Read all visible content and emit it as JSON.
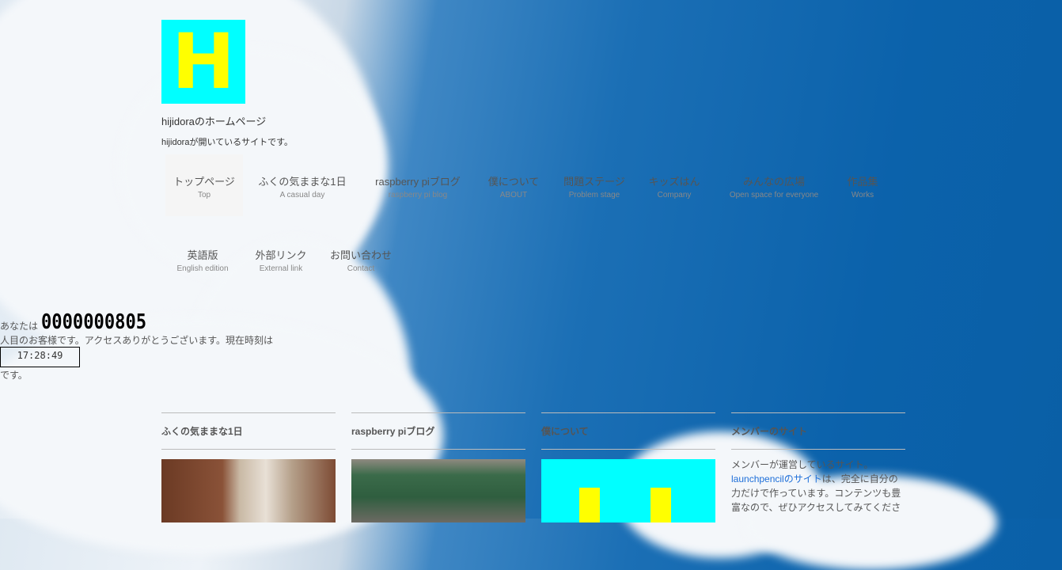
{
  "site": {
    "logo_letter": "H",
    "title": "hijidoraのホームページ",
    "description": "hijidoraが開いているサイトです。"
  },
  "nav": [
    {
      "label": "トップページ",
      "sub": "Top"
    },
    {
      "label": "ふくの気ままな1日",
      "sub": "A casual day"
    },
    {
      "label": "raspberry piブログ",
      "sub": "raspberry pi blog"
    },
    {
      "label": "僕について",
      "sub": "ABOUT"
    },
    {
      "label": "問題ステージ",
      "sub": "Problem stage"
    },
    {
      "label": "キッズはん",
      "sub": "Company"
    },
    {
      "label": "みんなの広場",
      "sub": "Open space for everyone"
    },
    {
      "label": "作品集",
      "sub": "Works"
    },
    {
      "label": "英語版",
      "sub": "English edition"
    },
    {
      "label": "外部リンク",
      "sub": "External link"
    },
    {
      "label": "お問い合わせ",
      "sub": "Contact"
    }
  ],
  "counter": {
    "prefix": "あなたは",
    "number": "0000000805",
    "line2": "人目のお客様です。アクセスありがとうございます。現在時刻は",
    "time": "17:28:49",
    "line3": "です。"
  },
  "widgets": [
    {
      "title": "ふくの気ままな1日"
    },
    {
      "title": "raspberry piブログ"
    },
    {
      "title": "僕について"
    },
    {
      "title": "メンバーのサイト",
      "text_pre": "メンバーが運営しているサイト。",
      "link": "launchpencilのサイト",
      "text_post": "は、完全に自分の力だけで作っています。コンテンツも豊富なので、ぜひアクセスしてみてくださ"
    }
  ],
  "colors": {
    "logo_bg": "#00ffff",
    "logo_fg": "#ffff00",
    "link": "#1e6fd9",
    "sky": "#0b62ab"
  }
}
